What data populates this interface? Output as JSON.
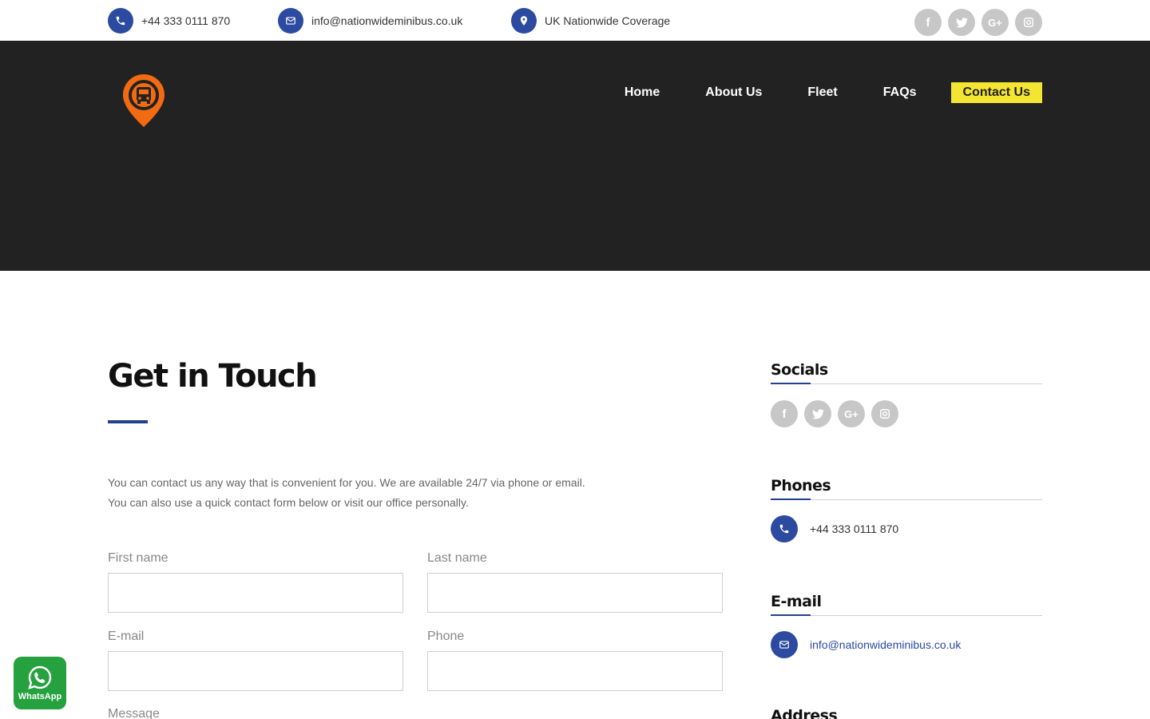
{
  "topbar": {
    "phone": "+44 333 0111 870",
    "email": "info@nationwideminibus.co.uk",
    "coverage": "UK Nationwide Coverage",
    "social_icons": [
      "facebook-icon",
      "twitter-icon",
      "google-plus-icon",
      "instagram-icon"
    ]
  },
  "nav": {
    "items": [
      "Home",
      "About Us",
      "Fleet",
      "FAQs"
    ],
    "active": "Contact Us"
  },
  "main": {
    "title": "Get in Touch",
    "intro_line1": "You can contact us any way that is convenient for you. We are available 24/7 via phone or email.",
    "intro_line2": "You can also use a quick contact form below or visit our office personally.",
    "form": {
      "first_name_label": "First name",
      "last_name_label": "Last name",
      "email_label": "E-mail",
      "phone_label": "Phone",
      "message_label": "Message"
    }
  },
  "sidebar": {
    "socials_heading": "Socials",
    "phones_heading": "Phones",
    "phone": "+44 333 0111 870",
    "email_heading": "E-mail",
    "email": "info@nationwideminibus.co.uk",
    "address_heading": "Address"
  },
  "whatsapp": {
    "label": "WhatsApp"
  },
  "colors": {
    "accent_blue": "#2b4aa0",
    "header_bg": "#222222",
    "nav_active": "#f4e532",
    "logo_orange": "#f26b12",
    "whatsapp_green": "#25a23f",
    "social_grey": "#c7c7c7"
  }
}
